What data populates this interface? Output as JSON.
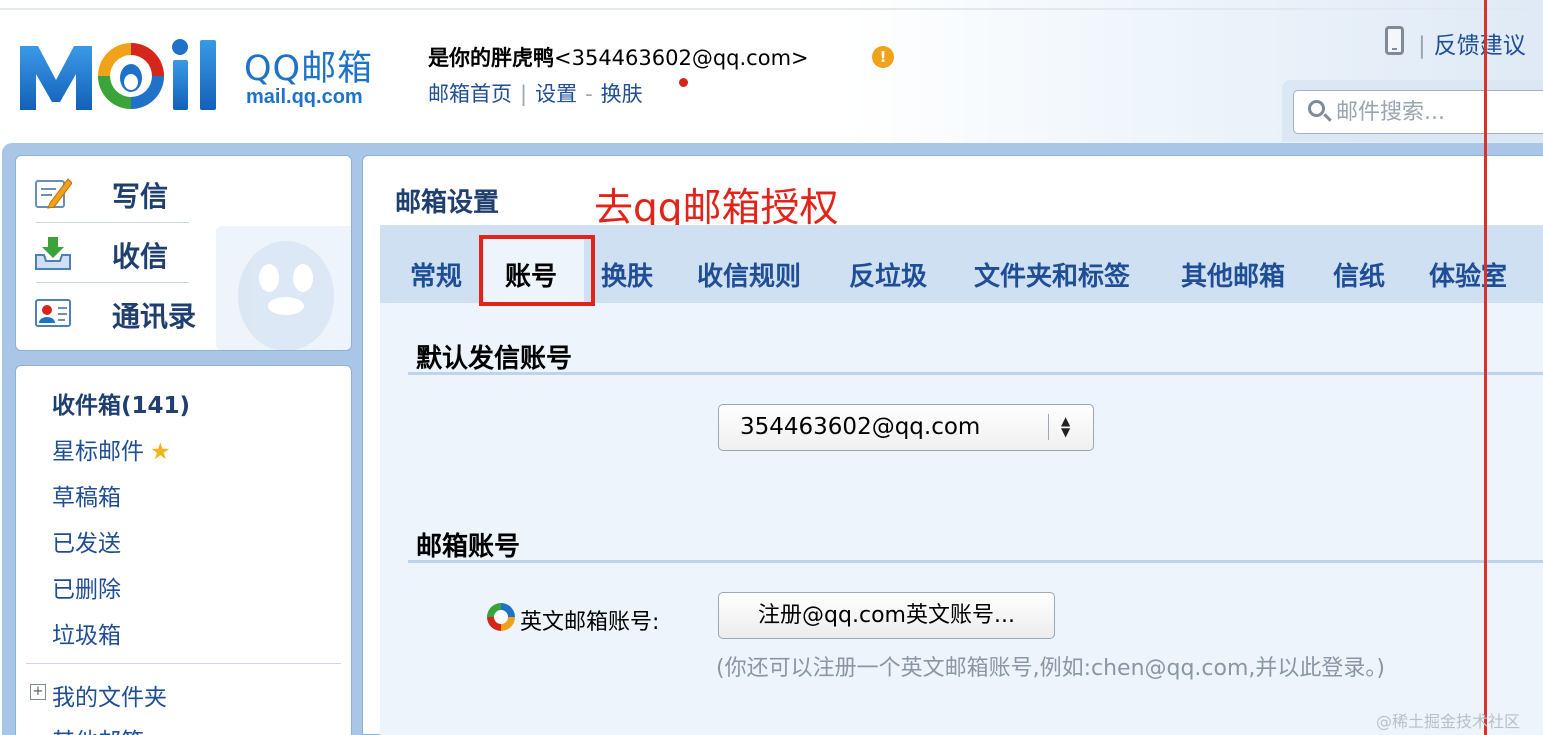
{
  "header": {
    "logo_title": "QQ邮箱",
    "logo_domain": "mail.qq.com",
    "user_name": "是你的胖虎鸭",
    "user_email": "<354463602@qq.com>",
    "links": [
      "邮箱首页",
      "设置",
      "换肤"
    ],
    "link_separators": [
      "|",
      "-"
    ],
    "feedback_sep": "|",
    "feedback": "反馈建议",
    "search_placeholder": "邮件搜索..."
  },
  "sidebar": {
    "actions": [
      {
        "label": "写信",
        "icon": "compose-icon"
      },
      {
        "label": "收信",
        "icon": "inbox-download-icon"
      },
      {
        "label": "通讯录",
        "icon": "contacts-icon"
      }
    ],
    "folders": [
      {
        "label": "收件箱(141)"
      },
      {
        "label": "星标邮件",
        "icon": "star-icon"
      },
      {
        "label": "草稿箱"
      },
      {
        "label": "已发送"
      },
      {
        "label": "已删除"
      },
      {
        "label": "垃圾箱"
      }
    ],
    "my_folders": "我的文件夹",
    "other_mailboxes": "其他邮箱"
  },
  "main": {
    "title": "邮箱设置",
    "annotation": "去qq邮箱授权",
    "tabs": [
      "常规",
      "账号",
      "换肤",
      "收信规则",
      "反垃圾",
      "文件夹和标签",
      "其他邮箱",
      "信纸",
      "体验室"
    ],
    "active_tab": "账号",
    "sections": {
      "default_sender": {
        "title": "默认发信账号",
        "selected": "354463602@qq.com"
      },
      "mail_account": {
        "title": "邮箱账号",
        "field_label": "英文邮箱账号:",
        "button": "注册@qq.com英文账号...",
        "hint": "(你还可以注册一个英文邮箱账号,例如:chen@qq.com,并以此登录。)"
      }
    }
  },
  "watermark": "@稀土掘金技术社区",
  "colors": {
    "brand_blue": "#1e73c8",
    "link_blue": "#1f4e96",
    "annotation_red": "#e2231a",
    "frame_blue": "#a9c6e6"
  }
}
